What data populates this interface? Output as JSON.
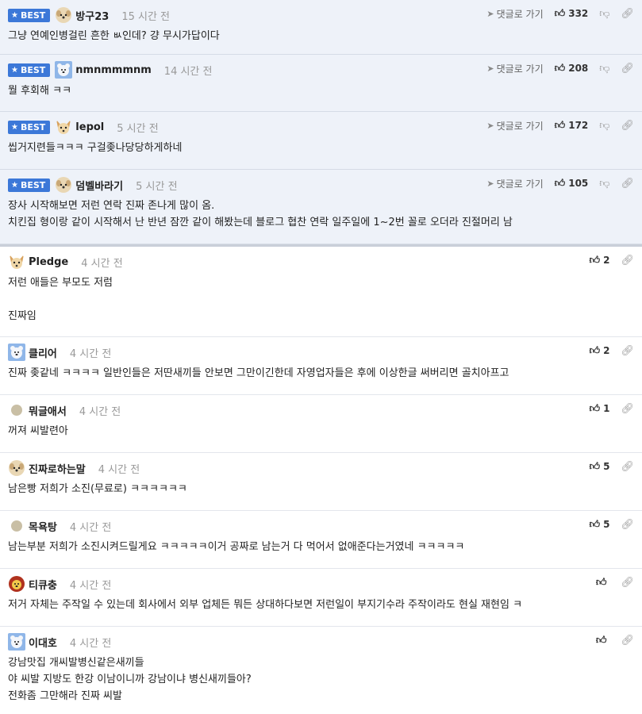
{
  "best_label": "BEST",
  "goto_label": "댓글로 가기",
  "best_comments": [
    {
      "nick": "방구23",
      "time": "15 시간 전",
      "likes": "332",
      "avatar": "dog-avatar-icon",
      "lines": [
        "그냥 연예인병걸린 흔한 ㅄ인데? 걍 무시가답이다"
      ]
    },
    {
      "nick": "nmnmmmnm",
      "time": "14 시간 전",
      "likes": "208",
      "avatar": "bear-avatar-icon",
      "lines": [
        "뭘 후회해 ㅋㅋ"
      ]
    },
    {
      "nick": "lepol",
      "time": "5 시간 전",
      "likes": "172",
      "avatar": "chihuahua-avatar-icon",
      "lines": [
        "씹거지련들ㅋㅋㅋ 구걸좆나당당하게하네"
      ]
    },
    {
      "nick": "덤벨바라기",
      "time": "5 시간 전",
      "likes": "105",
      "avatar": "dog-avatar-icon",
      "lines": [
        "장사 시작해보면 저런 연락 진짜 존나게 많이 옴.",
        "치킨집 형이랑 같이 시작해서 난 반년 잠깐 같이 해봤는데 블로그 협찬 연락 일주일에 1~2번 꼴로 오더라 진절머리 남"
      ]
    }
  ],
  "comments": [
    {
      "nick": "Pledge",
      "time": "4 시간 전",
      "likes": "2",
      "avatar": "chihuahua-avatar-icon",
      "lines": [
        "저런 애들은 부모도 저럼",
        "",
        "진짜임"
      ]
    },
    {
      "nick": "클리어",
      "time": "4 시간 전",
      "likes": "2",
      "avatar": "bear-avatar-icon",
      "lines": [
        "진짜 좆같네 ㅋㅋㅋㅋ 일반인들은 저딴새끼들 안보면 그만이긴한데 자영업자들은 후에 이상한글 써버리면 골치아프고"
      ]
    },
    {
      "nick": "뭐글애서",
      "time": "4 시간 전",
      "likes": "1",
      "avatar": "dot-avatar-icon",
      "lines": [
        "꺼져 씨발련아"
      ]
    },
    {
      "nick": "진짜로하는말",
      "time": "4 시간 전",
      "likes": "5",
      "avatar": "dog-avatar-icon",
      "lines": [
        "남은빵 저희가 소진(무료로) ㅋㅋㅋㅋㅋㅋ"
      ]
    },
    {
      "nick": "목욕탕",
      "time": "4 시간 전",
      "likes": "5",
      "avatar": "dot-avatar-icon",
      "lines": [
        "남는부분 저희가 소진시켜드릴게요 ㅋㅋㅋㅋㅋ이거 공짜로 남는거 다 먹어서 없애준다는거였네 ㅋㅋㅋㅋㅋ"
      ]
    },
    {
      "nick": "티큐충",
      "time": "4 시간 전",
      "likes": "",
      "avatar": "lion-avatar-icon",
      "lines": [
        "저거 자체는 주작일 수 있는데 회사에서 외부 업체든 뭐든 상대하다보면 저런일이 부지기수라 주작이라도 현실 재현임 ㅋ"
      ]
    },
    {
      "nick": "이대호",
      "time": "4 시간 전",
      "likes": "",
      "avatar": "bear-avatar-icon",
      "lines": [
        "강남맛집 개씨발병신같은새끼들",
        "야 씨발 지방도 한강 이남이니까 강남이냐 병신새끼들아?",
        "전화좀 그만해라 진짜 씨발"
      ]
    }
  ],
  "colors": {
    "best_badge": "#3c78d8",
    "best_bg": "#eef2f9"
  }
}
